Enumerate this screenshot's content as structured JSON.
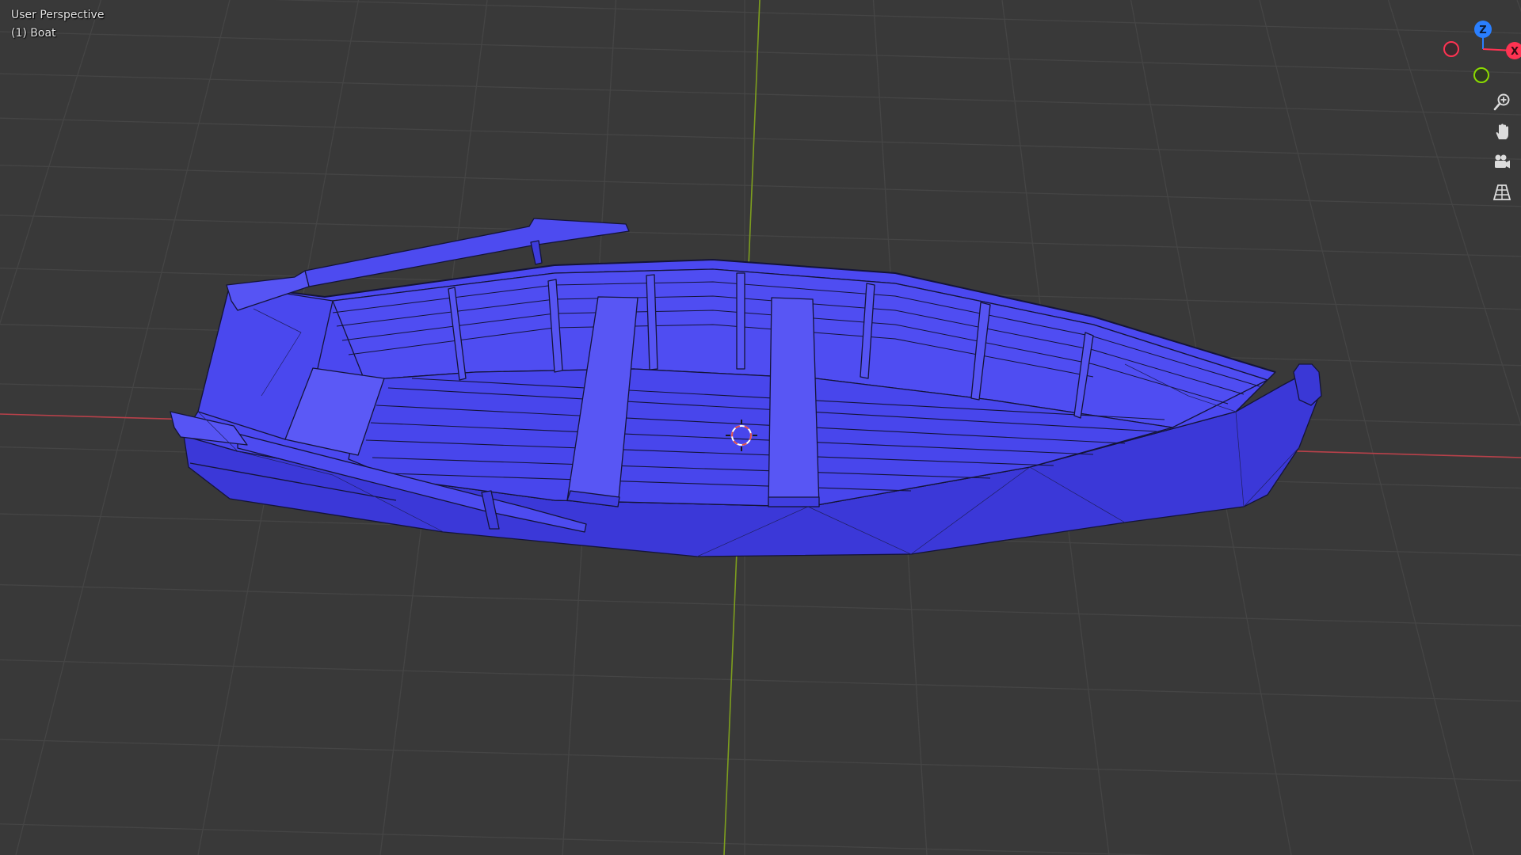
{
  "viewport": {
    "view_name": "User Perspective",
    "active_object": "(1) Boat"
  },
  "gizmo": {
    "axes": [
      {
        "axis": "z",
        "label": "Z",
        "color": "#2a7fff"
      },
      {
        "axis": "x",
        "label": "X",
        "color": "#ff3352"
      },
      {
        "axis": "y",
        "label": "",
        "color": "#8bdc00"
      },
      {
        "axis": "-x",
        "label": "",
        "color": "#ff3352"
      }
    ]
  },
  "nav_tools": [
    {
      "name": "zoom",
      "icon": "zoom-in-icon"
    },
    {
      "name": "pan",
      "icon": "hand-icon"
    },
    {
      "name": "camera",
      "icon": "camera-icon"
    },
    {
      "name": "projection",
      "icon": "grid-perspective-icon"
    }
  ],
  "colors": {
    "background": "#393939",
    "grid": "#454545",
    "x_axis": "#b8414a",
    "y_axis": "#7d9e1e",
    "mesh_fill": "#4b48f0",
    "mesh_shade": "#3b38d8",
    "mesh_light": "#5c5af5",
    "wire": "#141438",
    "cursor": "#e05050"
  }
}
